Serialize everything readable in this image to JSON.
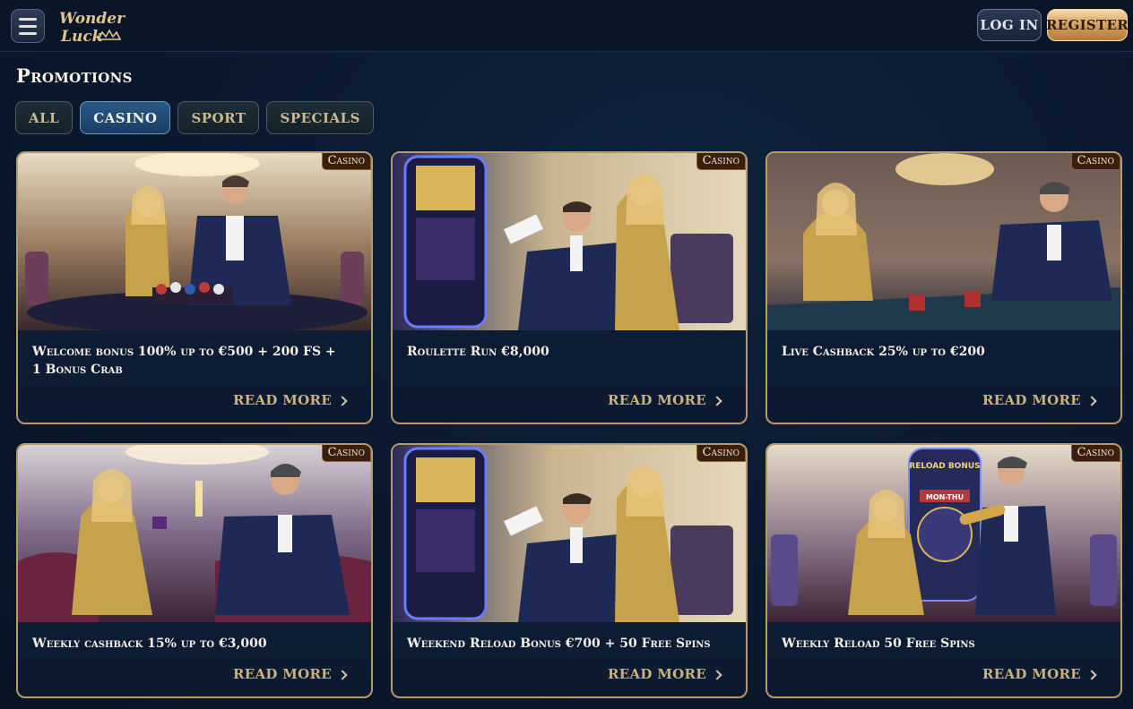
{
  "header": {
    "logo": "Wonder Luck",
    "login_label": "LOG IN",
    "register_label": "REGISTER"
  },
  "page_title": "Promotions",
  "filters": [
    {
      "label": "ALL",
      "active": false
    },
    {
      "label": "CASINO",
      "active": true
    },
    {
      "label": "SPORT",
      "active": false
    },
    {
      "label": "SPECIALS",
      "active": false
    }
  ],
  "cards": [
    {
      "badge": "Casino",
      "title": "Welcome bonus 100% up to €500 + 200 FS + 1 Bonus Crab",
      "cta": "READ MORE",
      "image": "casino-couple-poker-chips"
    },
    {
      "badge": "Casino",
      "title": "Roulette Run €8,000",
      "cta": "READ MORE",
      "image": "casino-couple-slot-machine"
    },
    {
      "badge": "Casino",
      "title": "Live Cashback 25% up to €200",
      "cta": "READ MORE",
      "image": "casino-couple-roulette-table"
    },
    {
      "badge": "Casino",
      "title": "Weekly cashback 15% up to €3,000",
      "cta": "READ MORE",
      "image": "casino-couple-lounge-champagne"
    },
    {
      "badge": "Casino",
      "title": "Weekend Reload Bonus €700 + 50 Free Spins",
      "cta": "READ MORE",
      "image": "casino-couple-slot-machine"
    },
    {
      "badge": "Casino",
      "title": "Weekly Reload 50 Free Spins",
      "cta": "READ MORE",
      "image": "casino-couple-reload-bonus-machine",
      "image_text": [
        "RELOAD BONUS",
        "MON-THU"
      ]
    }
  ],
  "colors": {
    "background": "#0b1a30",
    "card_border": "#b69a67",
    "accent_gold": "#d29a57",
    "active_filter": "#285a85",
    "read_more": "#cbb17e"
  }
}
